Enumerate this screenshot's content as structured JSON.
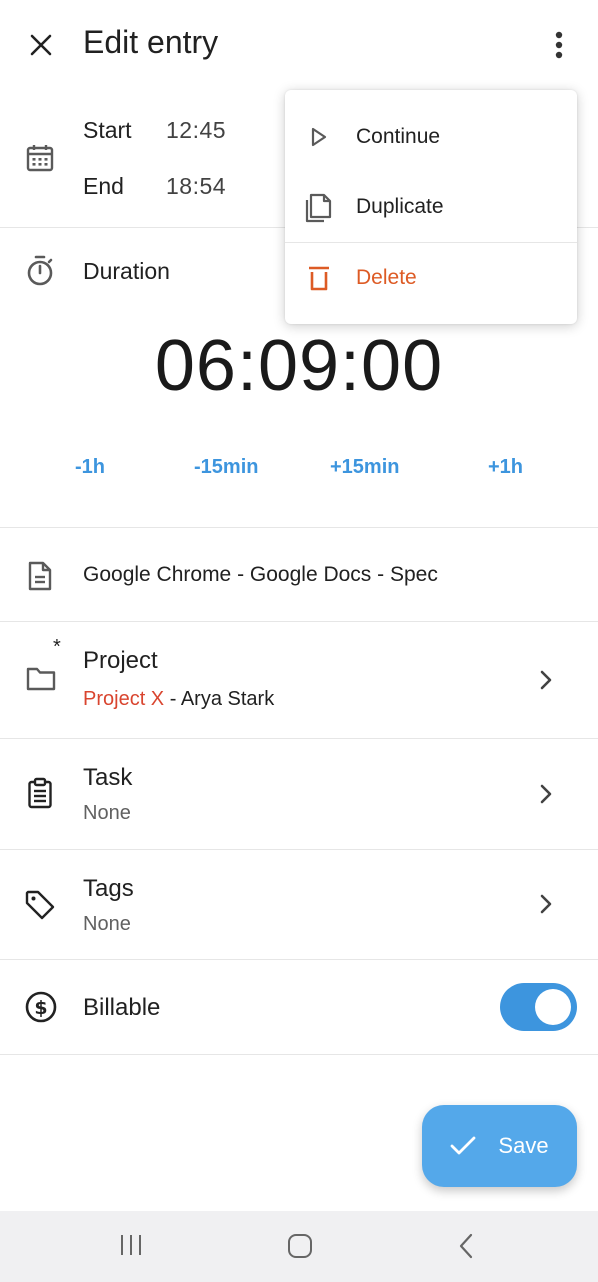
{
  "header": {
    "title": "Edit entry",
    "close_icon": "close-icon",
    "more_icon": "more-vert-icon"
  },
  "time": {
    "start_label": "Start",
    "start_value": "12:45",
    "end_label": "End",
    "end_value": "18:54"
  },
  "duration": {
    "label": "Duration",
    "value": "06:09:00",
    "adjustments": [
      "-1h",
      "-15min",
      "+15min",
      "+1h"
    ]
  },
  "description": {
    "text": "Google Chrome - Google Docs - Spec"
  },
  "project": {
    "label": "Project",
    "required_marker": "*",
    "project_name": "Project X",
    "separator": " - ",
    "client_name": "Arya Stark",
    "project_color": "#d9452f"
  },
  "task": {
    "label": "Task",
    "value": "None"
  },
  "tags": {
    "label": "Tags",
    "value": "None"
  },
  "billable": {
    "label": "Billable",
    "enabled": true
  },
  "save": {
    "label": "Save"
  },
  "menu": {
    "items": [
      {
        "label": "Continue",
        "icon": "play-icon"
      },
      {
        "label": "Duplicate",
        "icon": "copy-icon"
      },
      {
        "label": "Delete",
        "icon": "trash-icon"
      }
    ],
    "delete_color": "#dd5b25"
  },
  "colors": {
    "accent": "#3d95de",
    "fab": "#54a8ea"
  }
}
